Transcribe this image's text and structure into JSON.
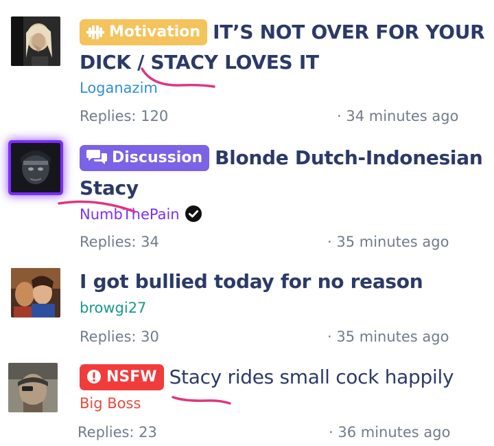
{
  "threads": [
    {
      "badge": {
        "label": "Motivation",
        "icon": "dumbbell-icon",
        "color": "#f5c35c"
      },
      "title_line1": "IT’S NOT OVER FOR YOUR",
      "title_line2": "DICK / STACY LOVES IT",
      "author": "Loganazim",
      "author_color": "#2f8fd8",
      "replies": "Replies: 120",
      "time": "· 34 minutes ago"
    },
    {
      "badge": {
        "label": "Discussion",
        "icon": "chat-bubbles-icon",
        "color": "#7a63e6"
      },
      "title_line1": "Blonde Dutch-Indonesian",
      "title_line2": "Stacy",
      "author": "NumbThePain",
      "author_color": "#7b2ff7",
      "verified": true,
      "replies": "Replies: 34",
      "time": "· 35 minutes ago"
    },
    {
      "title_line1": "I got bullied today for no reason",
      "author": "browgi27",
      "author_color": "#15998a",
      "replies": "Replies: 30",
      "time": "· 35 minutes ago"
    },
    {
      "badge": {
        "label": "NSFW",
        "icon": "exclamation-circle-icon",
        "color": "#f23b3b"
      },
      "title_line1": "Stacy rides small cock happily",
      "author": "Big Boss",
      "author_color": "#e84a3c",
      "replies": "Replies: 23",
      "time": "· 36 minutes ago"
    }
  ],
  "annotation_color": "#e0357e"
}
